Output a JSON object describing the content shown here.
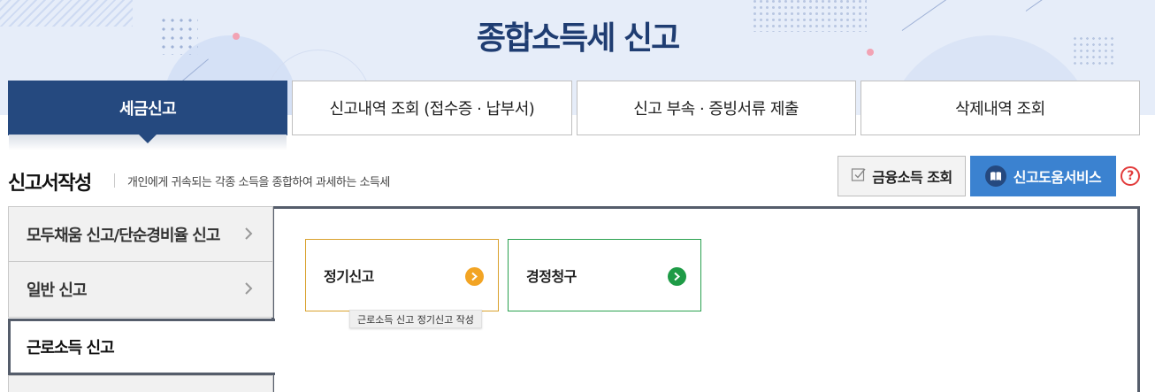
{
  "header": {
    "title": "종합소득세 신고"
  },
  "tabs": [
    {
      "label": "세금신고",
      "active": true
    },
    {
      "label": "신고내역 조회 (접수증 · 납부서)",
      "active": false
    },
    {
      "label": "신고 부속 · 증빙서류 제출",
      "active": false
    },
    {
      "label": "삭제내역 조회",
      "active": false
    }
  ],
  "section": {
    "title": "신고서작성",
    "description": "개인에게 귀속되는 각종 소득을 종합하여 과세하는 소득세"
  },
  "actions": {
    "finance_label": "금융소득 조회",
    "help_service_label": "신고도움서비스",
    "help_icon_glyph": "?"
  },
  "sidebar": {
    "items": [
      {
        "label": "모두채움 신고/단순경비율 신고",
        "selected": false
      },
      {
        "label": "일반 신고",
        "selected": false
      },
      {
        "label": "근로소득 신고",
        "selected": true
      }
    ]
  },
  "cards": [
    {
      "label": "정기신고",
      "color": "#f2a424"
    },
    {
      "label": "경정청구",
      "color": "#1e9b46"
    }
  ],
  "tooltip": {
    "text": "근로소득 신고 정기신고 작성"
  },
  "colors": {
    "primary": "#25497f",
    "accent_blue": "#3b82d0",
    "title_blue": "#1f3d72",
    "help_red": "#e23b3b"
  }
}
